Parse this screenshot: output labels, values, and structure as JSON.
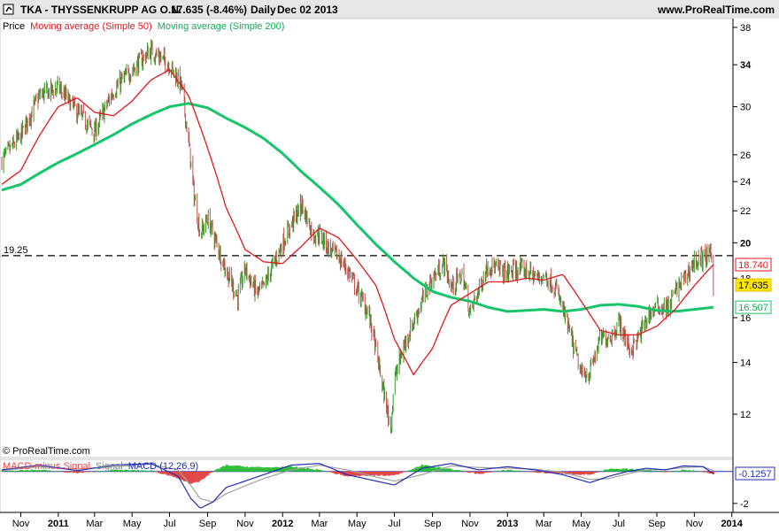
{
  "header": {
    "ticker_line": "TKA - THYSSENKRUPP AG O.N.",
    "quote": "17.635 (-8.46%)",
    "period": "Daily",
    "date": "Dec 02 2013",
    "site": "www.ProRealTime.com"
  },
  "legend": {
    "price_label": "Price",
    "ma50_label": "Moving average (Simple 50)",
    "ma200_label": "Moving average (Simple 200)"
  },
  "watermark": "© ProRealTime.com",
  "indicator_legend": {
    "hist_label": "MACD-minus Signal",
    "signal_label": "Signal",
    "macd_label": "MACD (12,26,9)"
  },
  "colors": {
    "up_candle": "#3a9a2a",
    "down_candle": "#c0504d",
    "ma50": "#e3161b",
    "ma200": "#18c46a",
    "macd": "#1f2fb0",
    "signal": "#a0a0a0",
    "hist_pos": "#2fbf3a",
    "hist_neg": "#e34848"
  },
  "chart_data": [
    {
      "type": "line",
      "title": "TKA - THYSSENKRUPP AG O.N.",
      "log_scale": true,
      "ylim": [
        10.8,
        38.5
      ],
      "y_ticks": [
        12,
        14,
        16,
        18,
        20,
        22,
        24,
        26,
        30,
        34,
        38
      ],
      "x_ticks": [
        "Nov",
        "2011",
        "Mar",
        "May",
        "Jul",
        "Sep",
        "Nov",
        "2012",
        "Mar",
        "May",
        "Jul",
        "Sep",
        "Nov",
        "2013",
        "Mar",
        "May",
        "Jul",
        "Sep",
        "Nov",
        "2014"
      ],
      "xlim": [
        "2010-10-01",
        "2013-12-31"
      ],
      "x_tick_dates": [
        "2010-11-01",
        "2011-01-01",
        "2011-03-01",
        "2011-05-01",
        "2011-07-01",
        "2011-09-01",
        "2011-11-01",
        "2012-01-01",
        "2012-03-01",
        "2012-05-01",
        "2012-07-01",
        "2012-09-01",
        "2012-11-01",
        "2013-01-01",
        "2013-03-01",
        "2013-05-01",
        "2013-07-01",
        "2013-09-01",
        "2013-11-01",
        "2014-01-01"
      ],
      "horizontal_line": {
        "value": 19.25,
        "label": "19.25",
        "style": "dashed"
      },
      "last_value_labels": [
        {
          "value": "18.740",
          "series": "Moving average (Simple 50)"
        },
        {
          "value": "17.635",
          "series": "Price"
        },
        {
          "value": "16.507",
          "series": "Moving average (Simple 200)"
        }
      ],
      "series": [
        {
          "name": "Price",
          "x": [
            "2010-10-01",
            "2010-11-01",
            "2010-12-01",
            "2011-01-01",
            "2011-02-01",
            "2011-03-01",
            "2011-04-01",
            "2011-05-01",
            "2011-06-01",
            "2011-07-01",
            "2011-07-20",
            "2011-08-01",
            "2011-08-10",
            "2011-08-20",
            "2011-09-01",
            "2011-09-15",
            "2011-10-01",
            "2011-10-20",
            "2011-11-01",
            "2011-11-20",
            "2011-12-01",
            "2011-12-20",
            "2012-01-01",
            "2012-01-20",
            "2012-02-01",
            "2012-02-20",
            "2012-03-01",
            "2012-03-20",
            "2012-04-01",
            "2012-04-20",
            "2012-05-01",
            "2012-05-20",
            "2012-06-01",
            "2012-06-15",
            "2012-06-25",
            "2012-07-01",
            "2012-07-15",
            "2012-08-01",
            "2012-08-20",
            "2012-09-01",
            "2012-09-20",
            "2012-10-01",
            "2012-10-20",
            "2012-11-01",
            "2012-11-20",
            "2012-12-01",
            "2012-12-20",
            "2013-01-01",
            "2013-01-20",
            "2013-02-01",
            "2013-02-20",
            "2013-03-01",
            "2013-03-20",
            "2013-04-01",
            "2013-04-15",
            "2013-05-01",
            "2013-05-15",
            "2013-06-01",
            "2013-06-20",
            "2013-07-01",
            "2013-07-20",
            "2013-08-01",
            "2013-08-20",
            "2013-09-01",
            "2013-09-20",
            "2013-10-01",
            "2013-10-20",
            "2013-11-01",
            "2013-11-20",
            "2013-11-29",
            "2013-12-02"
          ],
          "values": [
            25.6,
            27.5,
            31,
            31.8,
            29.5,
            27.8,
            31.5,
            33.5,
            35.5,
            34,
            32,
            27,
            23,
            20.5,
            21.5,
            20,
            18.4,
            17,
            18.5,
            17.2,
            17.5,
            19,
            20,
            21.5,
            22.4,
            20.5,
            20.5,
            19.5,
            19.2,
            18.2,
            17.4,
            16.2,
            14.5,
            12.6,
            11.5,
            13.3,
            14.6,
            15.8,
            17.2,
            18,
            18.8,
            17.5,
            18.2,
            16.2,
            17.8,
            18.8,
            18.4,
            18.3,
            18.5,
            18.4,
            18,
            18.2,
            17.5,
            16.4,
            15,
            13.5,
            13.6,
            15,
            15.2,
            15.8,
            14.5,
            15,
            16.2,
            16.5,
            16.5,
            17.3,
            18.2,
            18.9,
            19.2,
            19.3,
            17.635
          ]
        },
        {
          "name": "Moving average (Simple 50)",
          "x": [
            "2010-10-01",
            "2010-11-01",
            "2010-12-01",
            "2011-01-01",
            "2011-02-01",
            "2011-03-01",
            "2011-04-01",
            "2011-05-01",
            "2011-06-01",
            "2011-07-01",
            "2011-08-01",
            "2011-09-01",
            "2011-10-01",
            "2011-11-01",
            "2011-12-01",
            "2012-01-01",
            "2012-02-01",
            "2012-03-01",
            "2012-04-01",
            "2012-05-01",
            "2012-06-01",
            "2012-07-01",
            "2012-08-01",
            "2012-09-01",
            "2012-10-01",
            "2012-11-01",
            "2012-12-01",
            "2013-01-01",
            "2013-02-01",
            "2013-03-01",
            "2013-04-01",
            "2013-05-01",
            "2013-06-01",
            "2013-07-01",
            "2013-08-01",
            "2013-09-01",
            "2013-10-01",
            "2013-11-01",
            "2013-12-02"
          ],
          "values": [
            23.8,
            24.8,
            27.5,
            30,
            30.8,
            29.5,
            29.2,
            30.5,
            32.5,
            33.5,
            31,
            26.5,
            22.2,
            19.6,
            18.9,
            18.8,
            19.8,
            20.9,
            20.3,
            19,
            17.6,
            15,
            13.5,
            14.6,
            16.6,
            17.2,
            17.8,
            17.8,
            18,
            17.9,
            18.2,
            16.8,
            15.4,
            15.2,
            15.2,
            15.6,
            16.4,
            17.6,
            18.74
          ]
        },
        {
          "name": "Moving average (Simple 200)",
          "x": [
            "2010-10-01",
            "2010-11-01",
            "2010-12-01",
            "2011-01-01",
            "2011-02-01",
            "2011-03-01",
            "2011-04-01",
            "2011-05-01",
            "2011-06-01",
            "2011-07-01",
            "2011-08-01",
            "2011-09-01",
            "2011-10-01",
            "2011-11-01",
            "2011-12-01",
            "2012-01-01",
            "2012-02-01",
            "2012-03-01",
            "2012-04-01",
            "2012-05-01",
            "2012-06-01",
            "2012-07-01",
            "2012-08-01",
            "2012-09-01",
            "2012-10-01",
            "2012-11-01",
            "2012-12-01",
            "2013-01-01",
            "2013-02-01",
            "2013-03-01",
            "2013-04-01",
            "2013-05-01",
            "2013-06-01",
            "2013-07-01",
            "2013-08-01",
            "2013-09-01",
            "2013-10-01",
            "2013-11-01",
            "2013-12-02"
          ],
          "values": [
            23.4,
            23.8,
            24.6,
            25.4,
            26.1,
            26.8,
            27.6,
            28.5,
            29.3,
            30,
            30.3,
            29.9,
            29,
            28.2,
            27.3,
            26.1,
            24.7,
            23.6,
            22.4,
            21.1,
            19.9,
            18.9,
            18,
            17.3,
            17,
            16.8,
            16.5,
            16.3,
            16.35,
            16.4,
            16.3,
            16.4,
            16.6,
            16.65,
            16.55,
            16.35,
            16.3,
            16.4,
            16.507
          ]
        }
      ]
    },
    {
      "type": "line",
      "title": "MACD (12,26,9)",
      "ylim": [
        -2.45,
        0.65
      ],
      "y_ticks": [
        -2
      ],
      "last_value_labels": [
        {
          "value": "-0.1257",
          "series": "MACD (12,26,9)"
        }
      ],
      "series": [
        {
          "name": "MACD (12,26,9)",
          "x": [
            "2010-10-01",
            "2010-12-01",
            "2011-02-01",
            "2011-04-01",
            "2011-06-01",
            "2011-07-15",
            "2011-08-05",
            "2011-08-20",
            "2011-09-10",
            "2011-10-01",
            "2011-11-01",
            "2011-12-01",
            "2012-01-15",
            "2012-03-01",
            "2012-04-15",
            "2012-06-01",
            "2012-07-01",
            "2012-08-15",
            "2012-10-01",
            "2012-11-15",
            "2013-01-01",
            "2013-02-15",
            "2013-04-01",
            "2013-05-15",
            "2013-06-15",
            "2013-07-15",
            "2013-08-15",
            "2013-09-15",
            "2013-10-15",
            "2013-11-15",
            "2013-12-02"
          ],
          "values": [
            0.1,
            0.4,
            0.05,
            0.4,
            0.5,
            -0.3,
            -1.7,
            -2.3,
            -1.9,
            -1.0,
            -0.6,
            -0.2,
            0.4,
            0.5,
            -0.2,
            -0.6,
            -0.85,
            0.2,
            0.5,
            0.1,
            0.3,
            0.1,
            -0.2,
            -0.7,
            -0.3,
            0.0,
            0.2,
            0.1,
            0.35,
            0.3,
            -0.1257
          ]
        },
        {
          "name": "Signal",
          "x": [
            "2010-10-01",
            "2010-12-01",
            "2011-02-01",
            "2011-04-01",
            "2011-06-01",
            "2011-07-15",
            "2011-08-05",
            "2011-08-20",
            "2011-09-10",
            "2011-10-01",
            "2011-11-01",
            "2011-12-01",
            "2012-01-15",
            "2012-03-01",
            "2012-04-15",
            "2012-06-01",
            "2012-07-01",
            "2012-08-15",
            "2012-10-01",
            "2012-11-15",
            "2013-01-01",
            "2013-02-15",
            "2013-04-01",
            "2013-05-15",
            "2013-06-15",
            "2013-07-15",
            "2013-08-15",
            "2013-09-15",
            "2013-10-15",
            "2013-11-15",
            "2013-12-02"
          ],
          "values": [
            0.05,
            0.3,
            0.15,
            0.3,
            0.45,
            0.1,
            -0.9,
            -1.7,
            -1.9,
            -1.4,
            -0.9,
            -0.45,
            0.1,
            0.4,
            0.1,
            -0.35,
            -0.6,
            -0.2,
            0.35,
            0.25,
            0.2,
            0.15,
            -0.05,
            -0.5,
            -0.45,
            -0.15,
            0.1,
            0.12,
            0.25,
            0.3,
            0.05
          ]
        },
        {
          "name": "MACD-minus Signal",
          "x": [
            "2010-10-01",
            "2010-12-01",
            "2011-02-01",
            "2011-04-01",
            "2011-06-01",
            "2011-07-15",
            "2011-08-05",
            "2011-08-20",
            "2011-09-10",
            "2011-10-01",
            "2011-11-01",
            "2011-12-01",
            "2012-01-15",
            "2012-03-01",
            "2012-04-15",
            "2012-06-01",
            "2012-07-01",
            "2012-08-15",
            "2012-10-01",
            "2012-11-15",
            "2013-01-01",
            "2013-02-15",
            "2013-04-01",
            "2013-05-15",
            "2013-06-15",
            "2013-07-15",
            "2013-08-15",
            "2013-09-15",
            "2013-10-15",
            "2013-11-15",
            "2013-12-02"
          ],
          "values": [
            0.05,
            0.1,
            -0.1,
            0.1,
            0.05,
            -0.4,
            -0.8,
            -0.6,
            0.0,
            0.4,
            0.3,
            0.25,
            0.3,
            0.1,
            -0.3,
            -0.25,
            -0.25,
            0.4,
            0.15,
            -0.15,
            0.1,
            -0.05,
            -0.15,
            -0.2,
            0.15,
            0.15,
            0.1,
            -0.02,
            0.1,
            0.0,
            -0.18
          ]
        }
      ]
    }
  ]
}
